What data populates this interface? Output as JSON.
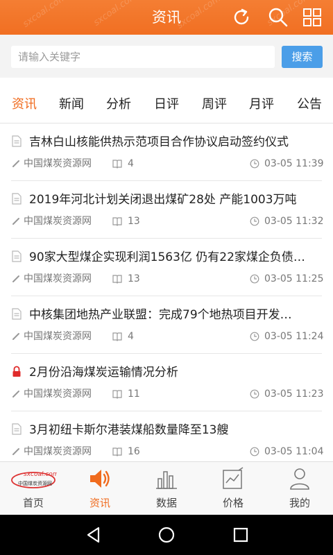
{
  "header": {
    "title": "资讯",
    "watermark": "sxcoal.com"
  },
  "search": {
    "placeholder": "请输入关键字",
    "value": "",
    "button_label": "搜索"
  },
  "tabs": [
    {
      "label": "资讯",
      "active": true
    },
    {
      "label": "新闻",
      "active": false
    },
    {
      "label": "分析",
      "active": false
    },
    {
      "label": "日评",
      "active": false
    },
    {
      "label": "周评",
      "active": false
    },
    {
      "label": "月评",
      "active": false
    },
    {
      "label": "公告",
      "active": false
    }
  ],
  "news": [
    {
      "title": "吉林白山核能供热示范项目合作协议启动签约仪式",
      "source": "中国煤炭资源网",
      "count": "4",
      "time": "03-05 11:39",
      "icon": "document-icon"
    },
    {
      "title": "2019年河北计划关闭退出煤矿28处  产能1003万吨",
      "source": "中国煤炭资源网",
      "count": "13",
      "time": "03-05 11:32",
      "icon": "document-icon"
    },
    {
      "title": "90家大型煤企实现利润1563亿 仍有22家煤企负债…",
      "source": "中国煤炭资源网",
      "count": "13",
      "time": "03-05 11:25",
      "icon": "document-icon"
    },
    {
      "title": "中核集团地热产业联盟：完成79个地热项目开发…",
      "source": "中国煤炭资源网",
      "count": "4",
      "time": "03-05 11:24",
      "icon": "document-icon"
    },
    {
      "title": "2月份沿海煤炭运输情况分析",
      "source": "中国煤炭资源网",
      "count": "11",
      "time": "03-05 11:23",
      "icon": "lock-icon"
    },
    {
      "title": "3月初纽卡斯尔港装煤船数量降至13艘",
      "source": "中国煤炭资源网",
      "count": "16",
      "time": "03-05 11:04",
      "icon": "document-icon"
    }
  ],
  "bottom_nav": [
    {
      "label": "首页",
      "icon": "home-logo-icon",
      "active": false
    },
    {
      "label": "资讯",
      "icon": "speaker-icon",
      "active": true
    },
    {
      "label": "数据",
      "icon": "bar-chart-icon",
      "active": false
    },
    {
      "label": "价格",
      "icon": "price-chart-icon",
      "active": false
    },
    {
      "label": "我的",
      "icon": "user-icon",
      "active": false
    }
  ],
  "logo": {
    "brand": "sxcoal.com",
    "brand_cn": "中国煤炭资源网"
  },
  "colors": {
    "accent": "#f06b1e",
    "header": "#f47e33",
    "search_button": "#4b9ee8",
    "lock": "#e02b2b"
  }
}
